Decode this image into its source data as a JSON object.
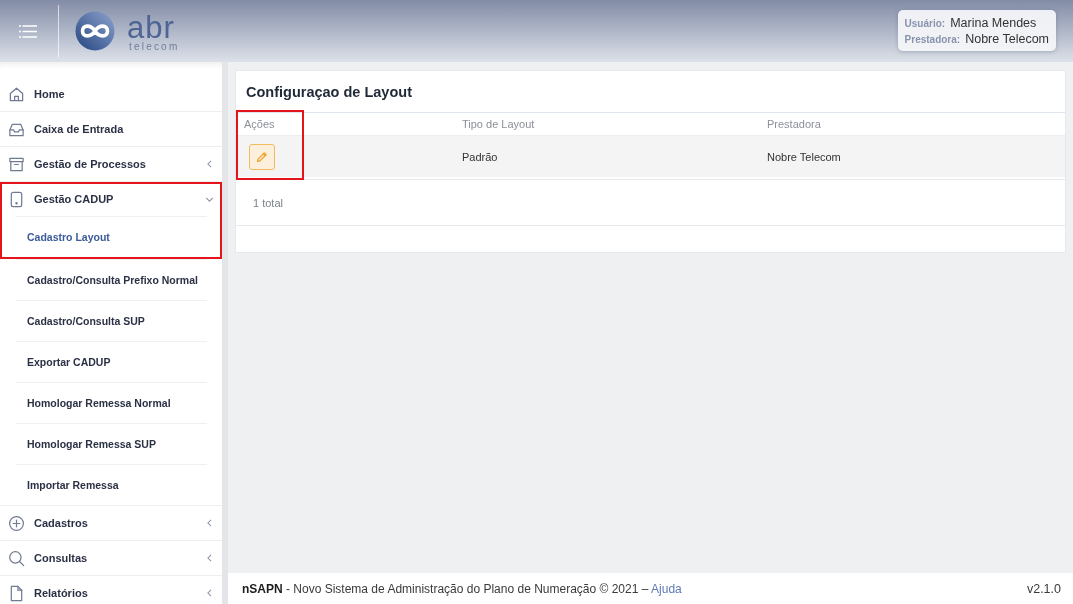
{
  "header": {
    "logo": {
      "name": "abr",
      "tagline": "telecom"
    },
    "user": {
      "label": "Usuário:",
      "value": "Marina Mendes"
    },
    "provider": {
      "label": "Prestadora:",
      "value": "Nobre Telecom"
    }
  },
  "sidebar": {
    "items": [
      {
        "label": "Home",
        "kind": "link",
        "highlighted": false
      },
      {
        "label": "Caixa de Entrada",
        "kind": "link",
        "highlighted": false
      },
      {
        "label": "Gestão de Processos",
        "kind": "group",
        "expanded": false,
        "highlighted": false
      },
      {
        "label": "Gestão CADUP",
        "kind": "group",
        "expanded": true,
        "highlighted": true,
        "children": [
          {
            "label": "Cadastro Layout",
            "selected": true,
            "highlighted": true
          },
          {
            "label": "Cadastro/Consulta Prefixo Normal",
            "selected": false,
            "highlighted": false
          },
          {
            "label": "Cadastro/Consulta SUP",
            "selected": false,
            "highlighted": false
          },
          {
            "label": "Exportar CADUP",
            "selected": false,
            "highlighted": false
          },
          {
            "label": "Homologar Remessa Normal",
            "selected": false,
            "highlighted": false
          },
          {
            "label": "Homologar Remessa SUP",
            "selected": false,
            "highlighted": false
          },
          {
            "label": "Importar Remessa",
            "selected": false,
            "highlighted": false
          }
        ]
      },
      {
        "label": "Cadastros",
        "kind": "group",
        "expanded": false,
        "highlighted": false
      },
      {
        "label": "Consultas",
        "kind": "group",
        "expanded": false,
        "highlighted": false
      },
      {
        "label": "Relatórios",
        "kind": "group",
        "expanded": false,
        "highlighted": false
      }
    ]
  },
  "page": {
    "title": "Configuraçao de Layout",
    "table": {
      "columns": [
        {
          "label": "Ações",
          "highlighted": true
        },
        {
          "label": "Tipo de Layout",
          "highlighted": false
        },
        {
          "label": "Prestadora",
          "highlighted": false
        }
      ],
      "rows": [
        {
          "layout_type": "Padrão",
          "provider": "Nobre Telecom"
        }
      ]
    },
    "total": "1 total"
  },
  "footer": {
    "text": "**nSAPN** - Novo Sistema de Administração do Plano de Numeração © 2021 –",
    "link": "Ajuda",
    "version": "v2.1.0"
  }
}
